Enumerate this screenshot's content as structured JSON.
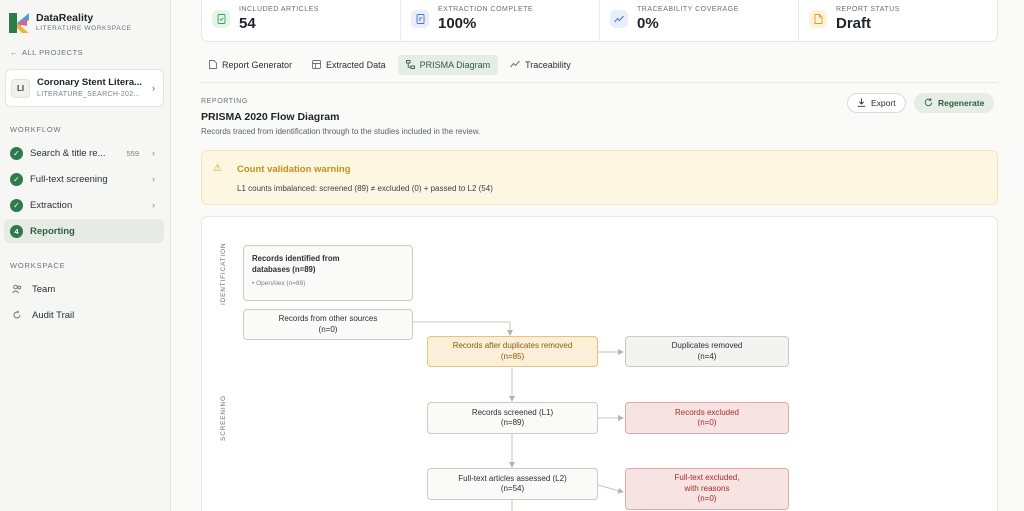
{
  "brand": {
    "name": "DataReality",
    "subtitle": "LITERATURE WORKSPACE"
  },
  "sidebar": {
    "back_label": "ALL PROJECTS",
    "project": {
      "initials": "LI",
      "name": "Coronary Stent Litera...",
      "id": "LITERATURE_SEARCH-202..."
    },
    "workflow_label": "WORKFLOW",
    "workflow": [
      {
        "label": "Search & title re...",
        "count": "559"
      },
      {
        "label": "Full-text screening"
      },
      {
        "label": "Extraction"
      },
      {
        "label": "Reporting",
        "step": "4"
      }
    ],
    "workspace_label": "WORKSPACE",
    "workspace": [
      {
        "label": "Team",
        "icon": "team-icon"
      },
      {
        "label": "Audit Trail",
        "icon": "audit-trail-icon"
      }
    ]
  },
  "stats": [
    {
      "label": "INCLUDED ARTICLES",
      "value": "54",
      "color": "#e7f4ea",
      "icon": "article-icon"
    },
    {
      "label": "EXTRACTION COMPLETE",
      "value": "100%",
      "color": "#e8eefb",
      "icon": "extraction-icon"
    },
    {
      "label": "TRACEABILITY COVERAGE",
      "value": "0%",
      "color": "#e8eefb",
      "icon": "trend-icon"
    },
    {
      "label": "REPORT STATUS",
      "value": "Draft",
      "color": "#fdf3d8",
      "icon": "report-icon"
    }
  ],
  "tabs": [
    {
      "label": "Report Generator"
    },
    {
      "label": "Extracted Data"
    },
    {
      "label": "PRISMA Diagram"
    },
    {
      "label": "Traceability"
    }
  ],
  "report": {
    "eyebrow": "REPORTING",
    "title": "PRISMA 2020 Flow Diagram",
    "subtitle": "Records traced from identification through to the studies included in the review.",
    "export_label": "Export",
    "regenerate_label": "Regenerate"
  },
  "warning": {
    "title": "Count validation warning",
    "body": "L1 counts imbalanced: screened (89) ≠ excluded (0) + passed to L2 (54)"
  },
  "diagram": {
    "phase_identification": "IDENTIFICATION",
    "phase_screening": "SCREENING",
    "identified": {
      "title": "Records identified from databases (n=89)",
      "sub": "• OpenAlex (n=89)"
    },
    "other_sources": {
      "line1": "Records from other sources",
      "line2": "(n=0)"
    },
    "after_dupes": {
      "line1": "Records after duplicates removed",
      "line2": "(n=85)"
    },
    "dupes_removed": {
      "line1": "Duplicates removed",
      "line2": "(n=4)"
    },
    "screened": {
      "line1": "Records screened (L1)",
      "line2": "(n=89)"
    },
    "excluded": {
      "line1": "Records excluded",
      "line2": "(n=0)"
    },
    "fulltext": {
      "line1": "Full-text articles assessed (L2)",
      "line2": "(n=54)"
    },
    "fulltext_excluded": {
      "line1": "Full-text excluded,",
      "line2": "with reasons",
      "line3": "(n=0)"
    }
  }
}
